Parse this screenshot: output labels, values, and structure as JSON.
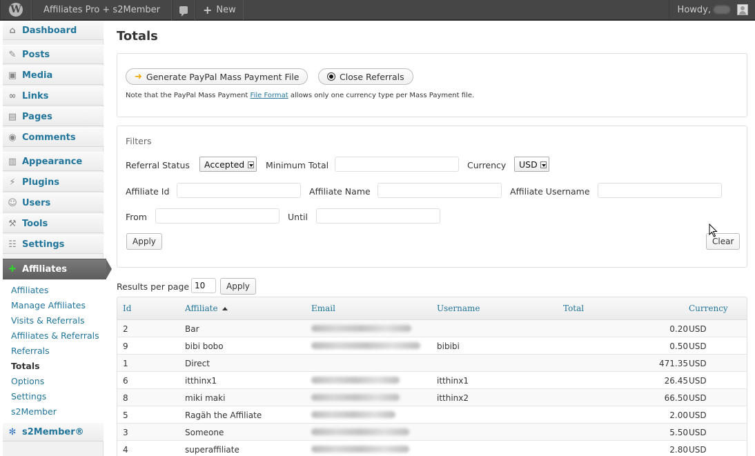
{
  "adminbar": {
    "site_name": "Affiliates Pro + s2Member",
    "new_label": "New",
    "howdy": "Howdy,"
  },
  "sidebar": {
    "items": [
      {
        "label": "Dashboard",
        "icon": "dashboard-icon"
      },
      {
        "label": "Posts",
        "icon": "pin-icon"
      },
      {
        "label": "Media",
        "icon": "media-icon"
      },
      {
        "label": "Links",
        "icon": "link-icon"
      },
      {
        "label": "Pages",
        "icon": "page-icon"
      },
      {
        "label": "Comments",
        "icon": "comment-icon"
      },
      {
        "label": "Appearance",
        "icon": "appearance-icon"
      },
      {
        "label": "Plugins",
        "icon": "plugin-icon"
      },
      {
        "label": "Users",
        "icon": "users-icon"
      },
      {
        "label": "Tools",
        "icon": "tools-icon"
      },
      {
        "label": "Settings",
        "icon": "settings-icon"
      },
      {
        "label": "Affiliates",
        "icon": "affiliates-icon"
      },
      {
        "label": "s2Member®",
        "icon": "s2member-icon"
      }
    ],
    "submenu": [
      "Affiliates",
      "Manage Affiliates",
      "Visits & Referrals",
      "Affiliates & Referrals",
      "Referrals",
      "Totals",
      "Options",
      "Settings",
      "s2Member"
    ],
    "current_sub": "Totals"
  },
  "page": {
    "title": "Totals",
    "generate_btn": "Generate PayPal Mass Payment File",
    "close_btn": "Close Referrals",
    "note_pre": "Note that the PayPal Mass Payment ",
    "note_link": "File Format",
    "note_post": " allows only one currency type per Mass Payment file."
  },
  "filters": {
    "heading": "Filters",
    "referral_status_label": "Referral Status",
    "referral_status_value": "Accepted",
    "min_total_label": "Minimum Total",
    "currency_label": "Currency",
    "currency_value": "USD",
    "affiliate_id_label": "Affiliate Id",
    "affiliate_name_label": "Affiliate Name",
    "affiliate_username_label": "Affiliate Username",
    "from_label": "From",
    "until_label": "Until",
    "apply_label": "Apply",
    "clear_label": "Clear"
  },
  "results": {
    "per_page_label": "Results per page",
    "per_page_value": "10",
    "apply_label": "Apply",
    "columns": [
      "Id",
      "Affiliate",
      "Email",
      "Username",
      "Total",
      "Currency"
    ],
    "rows": [
      {
        "id": "2",
        "affiliate": "Bar",
        "username": "",
        "total": "0.20",
        "currency": "USD",
        "email_w": 145
      },
      {
        "id": "9",
        "affiliate": "bibi bobo",
        "username": "bibibi",
        "total": "0.50",
        "currency": "USD",
        "email_w": 158
      },
      {
        "id": "1",
        "affiliate": "Direct",
        "username": "",
        "total": "471.35",
        "currency": "USD",
        "email_w": 0
      },
      {
        "id": "6",
        "affiliate": "itthinx1",
        "username": "itthinx1",
        "total": "26.45",
        "currency": "USD",
        "email_w": 128
      },
      {
        "id": "8",
        "affiliate": "miki maki",
        "username": "itthinx2",
        "total": "66.50",
        "currency": "USD",
        "email_w": 128
      },
      {
        "id": "5",
        "affiliate": "Ragäh the Affiliate",
        "username": "",
        "total": "2.00",
        "currency": "USD",
        "email_w": 122
      },
      {
        "id": "3",
        "affiliate": "Someone",
        "username": "",
        "total": "5.50",
        "currency": "USD",
        "email_w": 142
      },
      {
        "id": "4",
        "affiliate": "superaffiliate",
        "username": "",
        "total": "2.80",
        "currency": "USD",
        "email_w": 142
      }
    ]
  }
}
